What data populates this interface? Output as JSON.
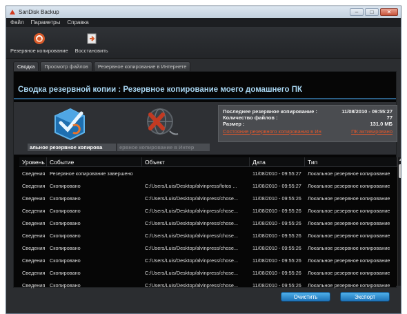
{
  "window": {
    "title": "SanDisk Backup"
  },
  "menu": [
    "Файл",
    "Параметры",
    "Справка"
  ],
  "toolbar": {
    "backup_label": "Резервное копирование",
    "restore_label": "Восстановить"
  },
  "tabs": [
    "Сводка",
    "Просмотр файлов",
    "Резервное копирование в Интернете"
  ],
  "summary": {
    "title": "Сводка резервной копии : Резервное копирование моего домашнего ПК",
    "caption_local": "альное резервное копирова",
    "caption_online": "ервное копирование в Интер"
  },
  "info": {
    "last_backup_label": "Последнее резервное копирование :",
    "last_backup_value": "11/08/2010 - 09:55:27",
    "file_count_label": "Количество файлов :",
    "file_count_value": "77",
    "size_label": "Размер :",
    "size_value": "131.0 МБ",
    "link_left": "Состояние резервного копирования в Ин",
    "link_right": "ПК активировано"
  },
  "log": {
    "headers": [
      "Уровень",
      "Событие",
      "Объект",
      "Дата",
      "Тип"
    ],
    "rows": [
      [
        "Сведения",
        "Резервное копирование завершено",
        "",
        "11/08/2010 - 09:55:27",
        "Локальное резервное копирование"
      ],
      [
        "Сведения",
        "Скопировано",
        "C:/Users/Luis/Desktop/alvinpress/fotos ...",
        "11/08/2010 - 09:55:27",
        "Локальное резервное копирование"
      ],
      [
        "Сведения",
        "Скопировано",
        "C:/Users/Luis/Desktop/alvinpress/chose...",
        "11/08/2010 - 09:55:26",
        "Локальное резервное копирование"
      ],
      [
        "Сведения",
        "Скопировано",
        "C:/Users/Luis/Desktop/alvinpress/chose...",
        "11/08/2010 - 09:55:26",
        "Локальное резервное копирование"
      ],
      [
        "Сведения",
        "Скопировано",
        "C:/Users/Luis/Desktop/alvinpress/chose...",
        "11/08/2010 - 09:55:26",
        "Локальное резервное копирование"
      ],
      [
        "Сведения",
        "Скопировано",
        "C:/Users/Luis/Desktop/alvinpress/chose...",
        "11/08/2010 - 09:55:26",
        "Локальное резервное копирование"
      ],
      [
        "Сведения",
        "Скопировано",
        "C:/Users/Luis/Desktop/alvinpress/chose...",
        "11/08/2010 - 09:55:26",
        "Локальное резервное копирование"
      ],
      [
        "Сведения",
        "Скопировано",
        "C:/Users/Luis/Desktop/alvinpress/chose...",
        "11/08/2010 - 09:55:26",
        "Локальное резервное копирование"
      ],
      [
        "Сведения",
        "Скопировано",
        "C:/Users/Luis/Desktop/alvinpress/chose...",
        "11/08/2010 - 09:55:26",
        "Локальное резервное копирование"
      ],
      [
        "Сведения",
        "Скопировано",
        "C:/Users/Luis/Desktop/alvinpress/chose...",
        "11/08/2010 - 09:55:26",
        "Локальное резервное копирование"
      ]
    ]
  },
  "buttons": {
    "clear": "Очистить",
    "export": "Экспорт"
  },
  "colors": {
    "accent": "#2b8fd6",
    "title_text": "#a8d6f2",
    "link": "#e2572b"
  },
  "icons": [
    "sandisk-logo-icon",
    "backup-icon",
    "restore-icon",
    "local-backup-icon",
    "online-backup-disabled-icon"
  ]
}
